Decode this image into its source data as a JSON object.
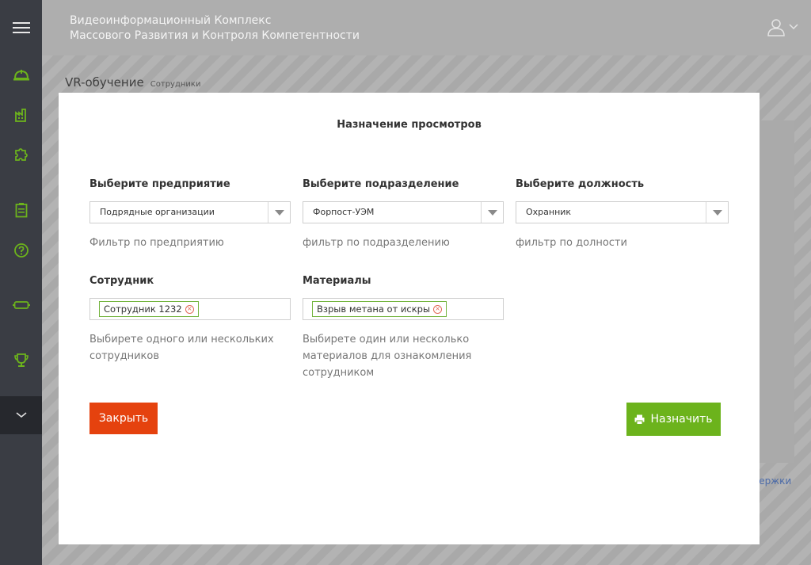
{
  "header": {
    "title_line1": "Видеоинформационный Комплекс",
    "title_line2": "Массового Развития и Контроля Компетентности"
  },
  "breadcrumb": {
    "main": "VR-обучение",
    "sub": "Сотрудники"
  },
  "background": {
    "link_fragment": "держки"
  },
  "sidebar": {
    "icons": [
      "menu-icon",
      "helmet-icon",
      "factory-icon",
      "puzzle-icon",
      "clipboard-icon",
      "help-icon",
      "vr-headset-icon",
      "trophy-icon",
      "chevron-down-icon"
    ],
    "accent_color": "#6cb31c"
  },
  "modal": {
    "title": "Назначение просмотров",
    "enterprise": {
      "label": "Выберите предприятие",
      "value": "Подрядные организации",
      "help": "Фильтр по предприятию"
    },
    "department": {
      "label": "Выберите подразделение",
      "value": "Форпост-УЭМ",
      "help": "фильтр по подразделению"
    },
    "position": {
      "label": "Выберите должность",
      "value": "Охранник",
      "help": "фильтр по долности"
    },
    "employee": {
      "label": "Сотрудник",
      "tag": "Сотрудник 1232",
      "help_line1": "Выбирете одного или нескольких",
      "help_line2": "сотрудников"
    },
    "materials": {
      "label": "Материалы",
      "tag": "Взрыв метана от искры",
      "help_line1": "Выбирете один или несколько",
      "help_line2": "материалов для ознакомления",
      "help_line3": "сотрудником"
    },
    "close_label": "Закрыть",
    "assign_label": "Назначить",
    "close_color": "#e5420e",
    "assign_color": "#6cb31c"
  }
}
